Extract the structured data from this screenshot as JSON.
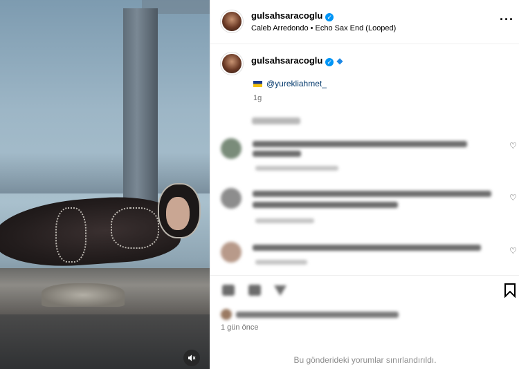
{
  "header": {
    "username": "gulsahsaracoglu",
    "audio": "Caleb Arredondo • Echo Sax End (Looped)",
    "more_icon": "more-horizontal-icon"
  },
  "caption": {
    "username": "gulsahsaracoglu",
    "mention": "@yurekliahmet_",
    "time": "1g"
  },
  "actions": {
    "icons": [
      "heart-icon",
      "comment-icon",
      "share-icon",
      "bookmark-icon"
    ]
  },
  "post": {
    "time": "1 gün önce",
    "comments_limited": "Bu gönderideki yorumlar sınırlandırıldı."
  },
  "colors": {
    "link": "#00376b",
    "verified": "#0095f6",
    "muted": "#737373"
  }
}
